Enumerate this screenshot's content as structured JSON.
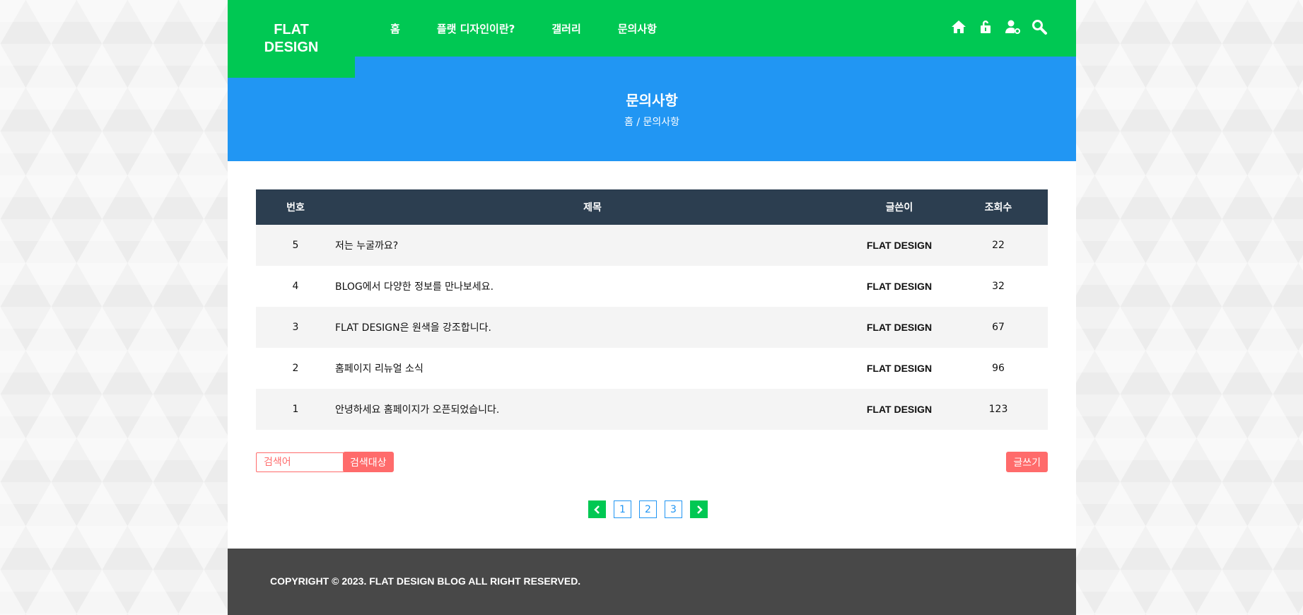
{
  "brand": {
    "line1": "FLAT",
    "line2": "DESIGN"
  },
  "nav": {
    "items": [
      {
        "label": "홈"
      },
      {
        "label": "플랫 디자인이란?"
      },
      {
        "label": "갤러리"
      },
      {
        "label": "문의사항"
      }
    ]
  },
  "header_icons": [
    "home-icon",
    "lock-icon",
    "user-settings-icon",
    "search-icon"
  ],
  "colors": {
    "green": "#00c853",
    "blue": "#2196f3",
    "table_header": "#2c3e50",
    "red": "#ff6b6b",
    "footer": "#484848"
  },
  "hero": {
    "title": "문의사항",
    "breadcrumb": "홈 / 문의사항"
  },
  "table": {
    "headers": {
      "num": "번호",
      "title": "제목",
      "author": "글쓴이",
      "views": "조회수"
    },
    "rows": [
      {
        "num": "5",
        "title": "저는 누굴까요?",
        "author": "FLAT DESIGN",
        "views": "22"
      },
      {
        "num": "4",
        "title": "BLOG에서 다양한 정보를 만나보세요.",
        "author": "FLAT DESIGN",
        "views": "32"
      },
      {
        "num": "3",
        "title": "FLAT DESIGN은 원색을 강조합니다.",
        "author": "FLAT DESIGN",
        "views": "67"
      },
      {
        "num": "2",
        "title": "홈페이지 리뉴얼 소식",
        "author": "FLAT DESIGN",
        "views": "96"
      },
      {
        "num": "1",
        "title": "안녕하세요 홈페이지가 오픈되었습니다.",
        "author": "FLAT DESIGN",
        "views": "123"
      }
    ]
  },
  "search": {
    "placeholder": "검색어",
    "button": "검색대상"
  },
  "write_button": "글쓰기",
  "pagination": {
    "prev": "‹",
    "pages": [
      "1",
      "2",
      "3"
    ],
    "next": "›"
  },
  "footer": {
    "copyright": "COPYRIGHT © 2023. FLAT DESIGN BLOG ALL RIGHT RESERVED."
  }
}
